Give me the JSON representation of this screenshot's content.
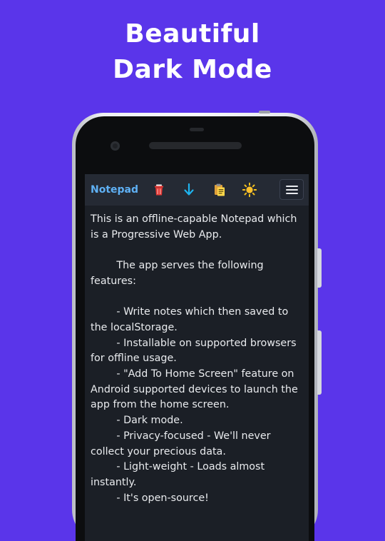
{
  "promo": {
    "line1": "Beautiful",
    "line2": "Dark Mode"
  },
  "app": {
    "brand": "Notepad",
    "toolbar": {
      "icons": [
        "trash-icon",
        "download-icon",
        "clipboard-icon",
        "sun-icon",
        "hamburger-menu-icon"
      ]
    },
    "note_text": "This is an offline-capable Notepad which is a Progressive Web App.\n\n        The app serves the following features:\n\n        - Write notes which then saved to the localStorage.\n        - Installable on supported browsers for offline usage.\n        - \"Add To Home Screen\" feature on Android supported devices to launch the app from the home screen.\n        - Dark mode.\n        - Privacy-focused - We'll never collect your precious data.\n        - Light-weight - Loads almost instantly.\n        - It's open-source!"
  },
  "colors": {
    "background": "#5a35ea",
    "navbar": "#252a34",
    "editor": "#1b1f26",
    "brand": "#5fb1f5",
    "text": "#e9ebee"
  }
}
